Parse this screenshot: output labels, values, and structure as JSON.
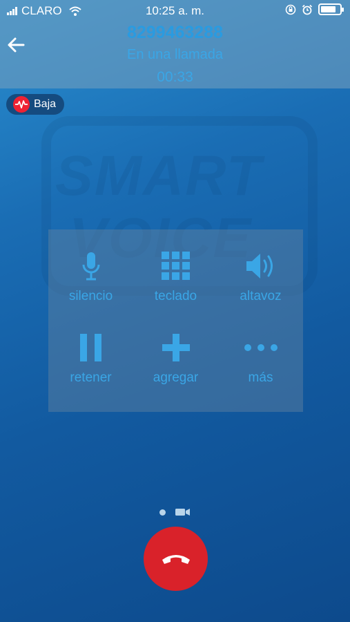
{
  "status_bar": {
    "carrier": "CLARO",
    "time": "10:25 a. m.",
    "battery_level": 0.8,
    "signal_bars": 4
  },
  "call": {
    "number": "8299463288",
    "state": "En una llamada",
    "duration": "00:33"
  },
  "quality": {
    "label": "Baja",
    "color": "#e22233"
  },
  "controls": [
    {
      "label": "silencio",
      "icon": "microphone-icon"
    },
    {
      "label": "teclado",
      "icon": "keypad-icon"
    },
    {
      "label": "altavoz",
      "icon": "speaker-icon"
    },
    {
      "label": "retener",
      "icon": "pause-icon"
    },
    {
      "label": "agregar",
      "icon": "plus-icon"
    },
    {
      "label": "más",
      "icon": "more-icon"
    }
  ],
  "colors": {
    "accent": "#3aa6e6",
    "hangup": "#d9222a"
  }
}
